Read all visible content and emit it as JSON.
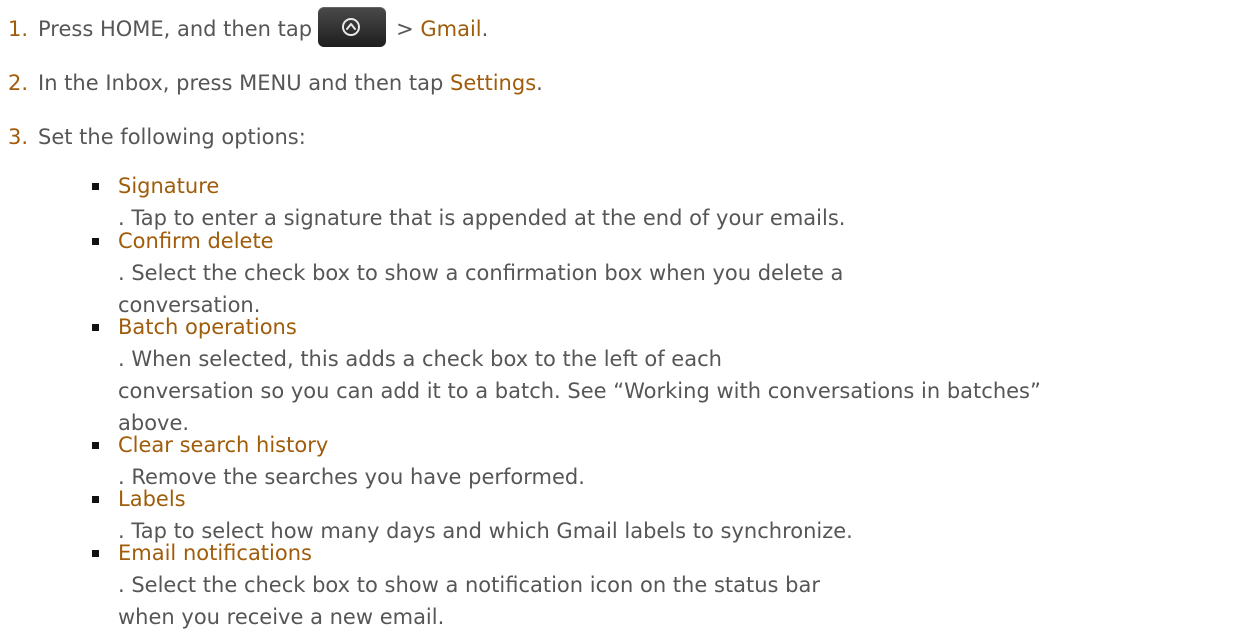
{
  "steps": [
    {
      "number": "1.",
      "before": "Press HOME, and then tap",
      "icon": "launcher-button-icon",
      "after_prefix": "> ",
      "highlight": "Gmail",
      "after_suffix": "."
    },
    {
      "number": "2.",
      "before": "In the Inbox, press MENU and then tap ",
      "highlight": "Settings",
      "after_suffix": "."
    },
    {
      "number": "3.",
      "text": "Set the following options:"
    }
  ],
  "options": [
    {
      "label": "Signature",
      "lines": [
        ". Tap to enter a signature that is appended at the end of your emails."
      ]
    },
    {
      "label": "Confirm delete",
      "lines": [
        ". Select the check box to show a confirmation box when you delete a",
        "conversation."
      ]
    },
    {
      "label": "Batch operations",
      "lines": [
        ". When selected, this adds a check box to the left of each",
        "conversation so you can add it to a batch. See “Working with conversations in batches”",
        "above."
      ]
    },
    {
      "label": "Clear search history",
      "lines": [
        ". Remove the searches you have performed."
      ]
    },
    {
      "label": "Labels",
      "lines": [
        ". Tap to select how many days and which Gmail labels to synchronize."
      ]
    },
    {
      "label": "Email notifications",
      "lines": [
        ". Select the check box to show a notification icon on the status bar",
        "when you receive a new email."
      ]
    }
  ],
  "colors": {
    "highlight": "#a05c0a",
    "body_text": "#565656",
    "bullet": "#111111"
  }
}
